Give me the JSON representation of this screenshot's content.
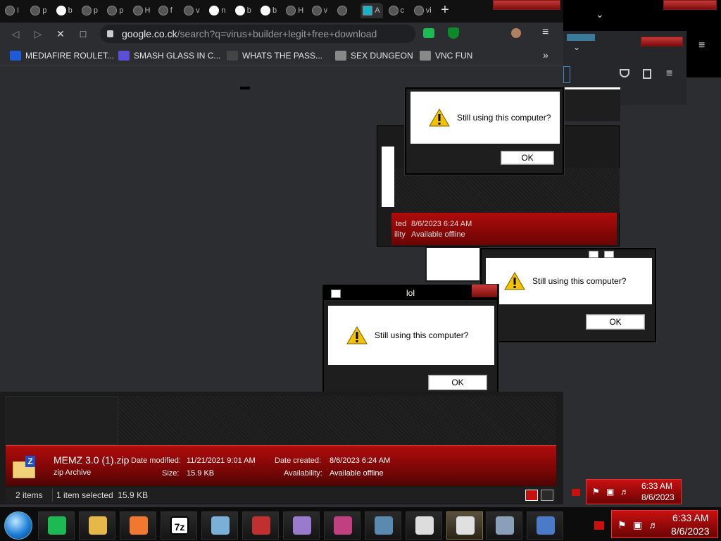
{
  "browser": {
    "tab_letters": [
      "I",
      "p",
      "b",
      "p",
      "p",
      "H",
      "f",
      "v",
      "n",
      "b",
      "b",
      "H",
      "v",
      "",
      "A",
      "c",
      "vi"
    ],
    "new_tab": "+",
    "url_host": "google.co.ck",
    "url_path": "/search?q=virus+builder+legit+free+download",
    "menu_glyph": "≡",
    "bookmarks": [
      {
        "label": "MEDIAFIRE ROULET...",
        "icon": "mediafire-icon",
        "color": "#1f5bd6"
      },
      {
        "label": "SMASH GLASS IN C...",
        "icon": "smash-icon",
        "color": "#5a4fd6"
      },
      {
        "label": "WHATS THE PASS...",
        "icon": "lock-icon",
        "color": "#444"
      },
      {
        "label": "SEX DUNGEON",
        "icon": "gear-icon",
        "color": "#888"
      },
      {
        "label": "VNC FUN",
        "icon": "gear-icon",
        "color": "#888"
      }
    ],
    "more": "»"
  },
  "dialogs": [
    {
      "message": "Still using this computer?",
      "ok": "OK",
      "title": ""
    },
    {
      "message": "Still using this computer?",
      "ok": "OK",
      "title": ""
    },
    {
      "message": "Still using this computer?",
      "ok": "OK",
      "title": "lol"
    }
  ],
  "ghost_details": {
    "created_label": "ted",
    "created_value": "8/6/2023 6:24 AM",
    "avail_label": "ility",
    "avail_value": "Available offline"
  },
  "explorer": {
    "file_name": "MEMZ 3.0 (1).zip",
    "file_type": "zip Archive",
    "date_modified_label": "Date modified:",
    "date_modified": "11/21/2021 9:01 AM",
    "size_label": "Size:",
    "size": "15.9 KB",
    "date_created_label": "Date created:",
    "date_created": "8/6/2023 6:24 AM",
    "availability_label": "Availability:",
    "availability": "Available offline",
    "items_count": "2 items",
    "selection": "1 item selected  15.9 KB"
  },
  "taskbar": {
    "apps": [
      "spotify",
      "file-explorer",
      "firefox-warning",
      "7zip",
      "notepad",
      "santa",
      "paint",
      "display",
      "network",
      "terminal",
      "calculator",
      "control-panel",
      "wordpad"
    ],
    "sevenzip_label": "7z",
    "time": "6:33 AM",
    "date": "8/6/2023"
  },
  "tray_secondary": {
    "time": "6:33 AM",
    "date": "8/6/2023"
  },
  "colors": {
    "accent_red": "#b00c0c",
    "chrome_bg": "#2b2d31"
  }
}
